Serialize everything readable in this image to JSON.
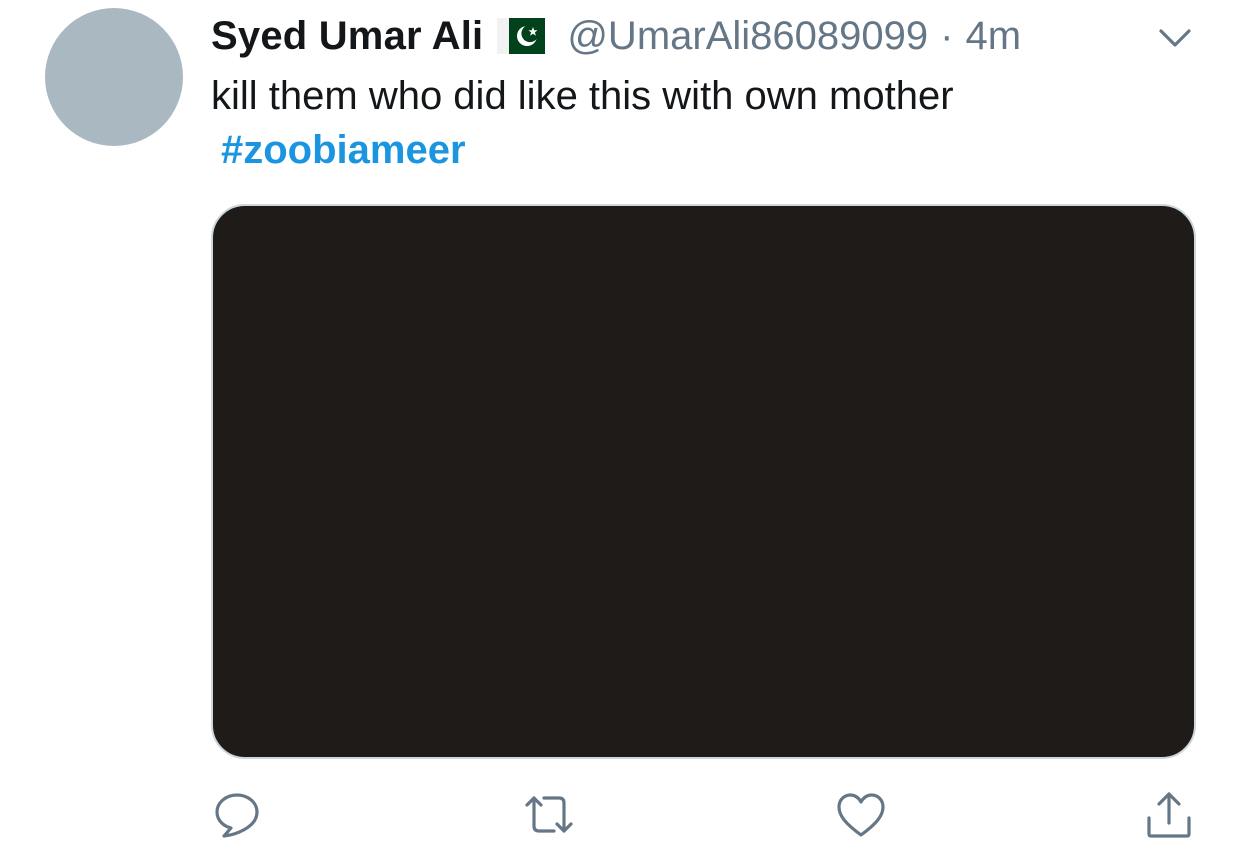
{
  "tweet": {
    "author": {
      "display_name": "Syed Umar Ali",
      "flag_icon": "pakistan-flag-icon",
      "handle": "@UmarAli86089099"
    },
    "separator": "·",
    "timestamp": "4m",
    "text": "kill them who did like this with own mother",
    "hashtag": "#zoobiameer",
    "colors": {
      "name": "#14171a",
      "muted": "#657786",
      "hashtag": "#1b95e0",
      "avatar_placeholder": "#aab8c2",
      "media_background": "#1f1b19"
    },
    "actions": [
      {
        "icon": "reply-icon"
      },
      {
        "icon": "retweet-icon"
      },
      {
        "icon": "like-icon"
      },
      {
        "icon": "share-icon"
      }
    ]
  }
}
